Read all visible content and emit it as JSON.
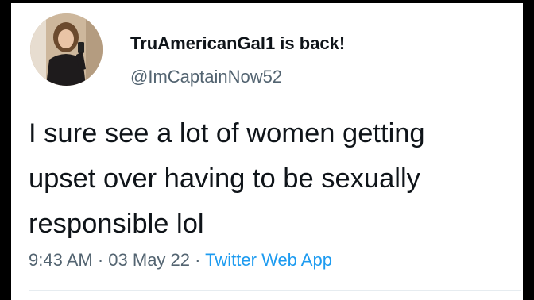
{
  "tweet": {
    "display_name": "TruAmericanGal1 is back!",
    "handle": "@ImCaptainNow52",
    "text_lines": [
      "I sure see a lot of women getting",
      "upset over having to be sexually",
      "responsible lol"
    ],
    "time": "9:43 AM",
    "separator": " · ",
    "date": "03 May 22",
    "source": "Twitter Web App"
  },
  "colors": {
    "background": "#000000",
    "card": "#ffffff",
    "text": "#0f1419",
    "secondary_text": "#536471",
    "link": "#1d9bf0"
  },
  "icons": {
    "avatar": "profile-photo-avatar"
  }
}
